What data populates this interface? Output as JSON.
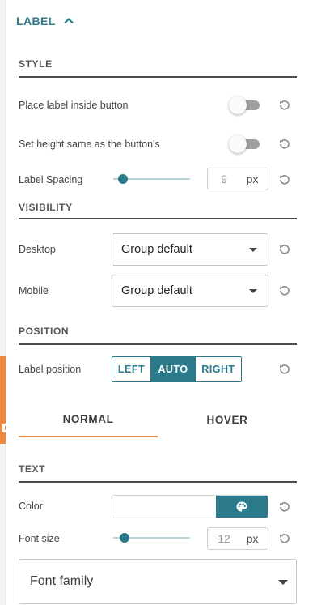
{
  "section": {
    "title": "LABEL"
  },
  "style": {
    "heading": "STYLE",
    "inside_label": "Place label inside button",
    "inside_on": false,
    "same_height_label": "Set height same as the button's",
    "same_height_on": false,
    "spacing_label": "Label Spacing",
    "spacing_value": "9",
    "spacing_unit": "px",
    "spacing_fraction": 0.07
  },
  "visibility": {
    "heading": "VISIBILITY",
    "desktop_label": "Desktop",
    "desktop_value": "Group default",
    "mobile_label": "Mobile",
    "mobile_value": "Group default"
  },
  "position": {
    "heading": "POSITION",
    "label": "Label position",
    "options": [
      "LEFT",
      "AUTO",
      "RIGHT"
    ],
    "selected": "AUTO"
  },
  "tabs": {
    "normal": "NORMAL",
    "hover": "HOVER",
    "active": "NORMAL"
  },
  "text": {
    "heading": "TEXT",
    "color_label": "Color",
    "color_value": "#ffffff",
    "font_size_label": "Font size",
    "font_size_value": "12",
    "font_size_unit": "px",
    "font_size_fraction": 0.1,
    "font_family_placeholder": "Font family"
  },
  "colors": {
    "accent": "#2a7a8b",
    "tab_indicator": "#f0883e"
  },
  "icons": [
    "chevron-up-icon",
    "reset-icon",
    "palette-icon",
    "caret-down-icon"
  ]
}
